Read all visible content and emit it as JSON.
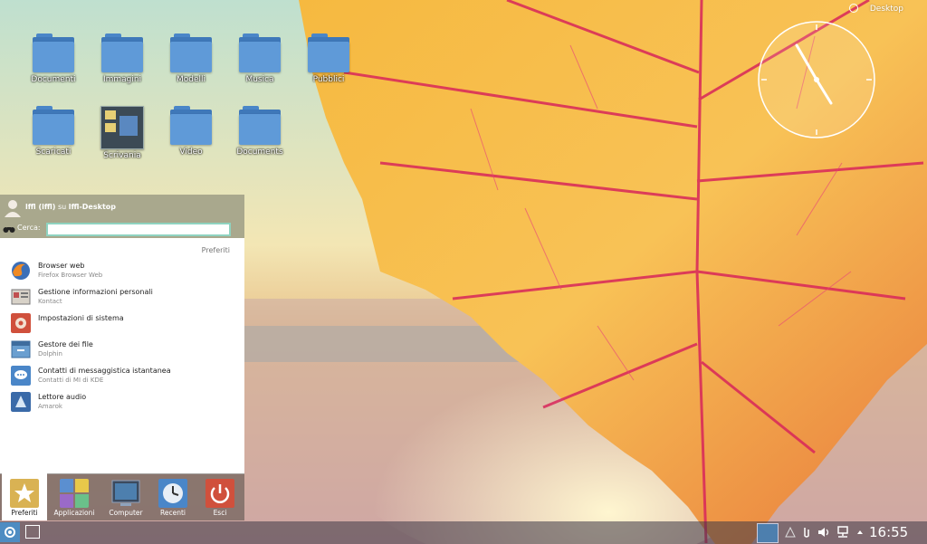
{
  "desktop": {
    "top_right_label": "Desktop",
    "icons": [
      {
        "label": "Documenti"
      },
      {
        "label": "Immagini"
      },
      {
        "label": "Modelli"
      },
      {
        "label": "Musica"
      },
      {
        "label": "Pubblici"
      },
      {
        "label": "Scaricati"
      },
      {
        "label": "Scrivania"
      },
      {
        "label": "Video"
      },
      {
        "label": "Documents"
      }
    ]
  },
  "start_menu": {
    "user_name": "lffl (lffl)",
    "user_sep": "su",
    "host": "lffl-Desktop",
    "search_label": "Cerca:",
    "search_value": "",
    "section_title": "Preferiti",
    "items": [
      {
        "title": "Browser web",
        "subtitle": "Firefox Browser Web",
        "icon": "firefox-icon"
      },
      {
        "title": "Gestione informazioni personali",
        "subtitle": "Kontact",
        "icon": "kontact-icon"
      },
      {
        "title": "Impostazioni di sistema",
        "subtitle": "",
        "icon": "settings-icon"
      },
      {
        "title": "Gestore dei file",
        "subtitle": "Dolphin",
        "icon": "dolphin-icon"
      },
      {
        "title": "Contatti di messaggistica istantanea",
        "subtitle": "Contatti di MI di KDE",
        "icon": "chat-icon"
      },
      {
        "title": "Lettore audio",
        "subtitle": "Amarok",
        "icon": "amarok-icon"
      }
    ],
    "tabs": [
      {
        "label": "Preferiti",
        "icon": "star-icon",
        "active": true
      },
      {
        "label": "Applicazioni",
        "icon": "apps-icon",
        "active": false
      },
      {
        "label": "Computer",
        "icon": "computer-icon",
        "active": false
      },
      {
        "label": "Recenti",
        "icon": "clock-icon",
        "active": false
      },
      {
        "label": "Esci",
        "icon": "power-icon",
        "active": false
      }
    ]
  },
  "taskbar": {
    "time": "16:55"
  },
  "colors": {
    "menu_header": "#a9a88d",
    "accent": "#4e8cc2",
    "search_border": "#8fd3c0"
  }
}
